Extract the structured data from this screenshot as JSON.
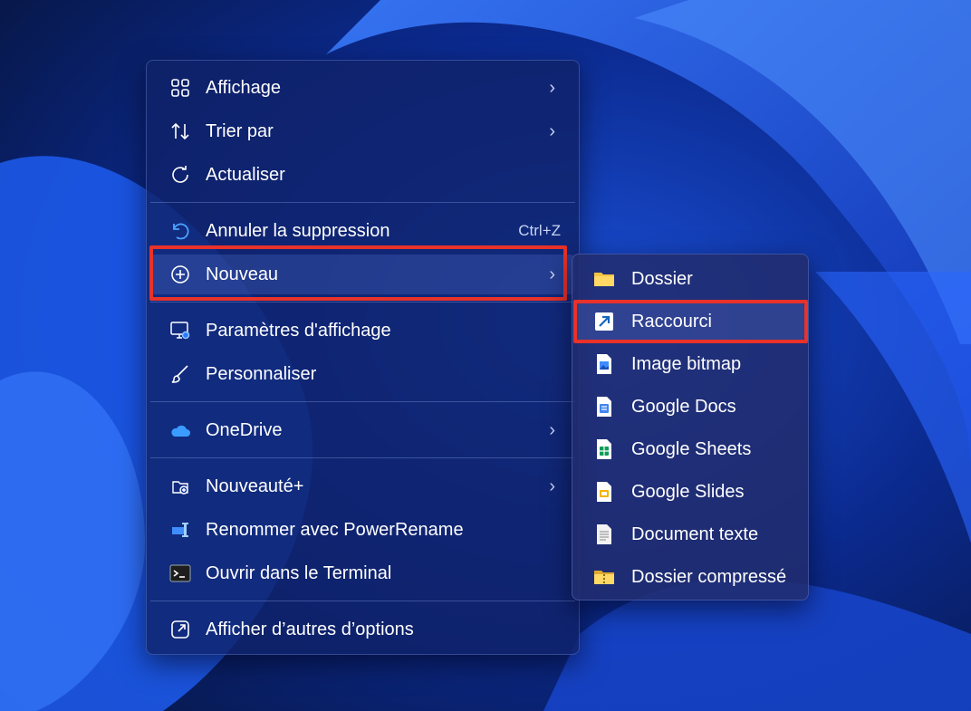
{
  "context_menu": {
    "items": [
      {
        "label": "Affichage",
        "icon": "grid-icon",
        "has_submenu": true
      },
      {
        "label": "Trier par",
        "icon": "sort-icon",
        "has_submenu": true
      },
      {
        "label": "Actualiser",
        "icon": "refresh-icon",
        "has_submenu": false
      },
      {
        "label": "Annuler la suppression",
        "icon": "undo-icon",
        "shortcut": "Ctrl+Z"
      },
      {
        "label": "Nouveau",
        "icon": "plus-circle-icon",
        "has_submenu": true
      },
      {
        "label": "Paramètres d'affichage",
        "icon": "display-settings-icon"
      },
      {
        "label": "Personnaliser",
        "icon": "brush-icon"
      },
      {
        "label": "OneDrive",
        "icon": "cloud-icon",
        "has_submenu": true
      },
      {
        "label": "Nouveauté+",
        "icon": "folder-new-icon",
        "has_submenu": true
      },
      {
        "label": "Renommer avec PowerRename",
        "icon": "powerrename-icon"
      },
      {
        "label": "Ouvrir dans le Terminal",
        "icon": "terminal-icon"
      },
      {
        "label": "Afficher d’autres d’options",
        "icon": "more-options-icon"
      }
    ],
    "chevron": "›"
  },
  "submenu_nouveau": {
    "items": [
      {
        "label": "Dossier",
        "icon": "folder-icon"
      },
      {
        "label": "Raccourci",
        "icon": "shortcut-arrow-icon"
      },
      {
        "label": "Image bitmap",
        "icon": "bitmap-file-icon"
      },
      {
        "label": "Google Docs",
        "icon": "google-docs-icon"
      },
      {
        "label": "Google Sheets",
        "icon": "google-sheets-icon"
      },
      {
        "label": "Google Slides",
        "icon": "google-slides-icon"
      },
      {
        "label": "Document texte",
        "icon": "text-file-icon"
      },
      {
        "label": "Dossier compressé",
        "icon": "zip-folder-icon"
      }
    ]
  },
  "colors": {
    "highlight_border": "#e8322a",
    "menu_bg": "#10226a",
    "accent": "#4aa3ff"
  }
}
